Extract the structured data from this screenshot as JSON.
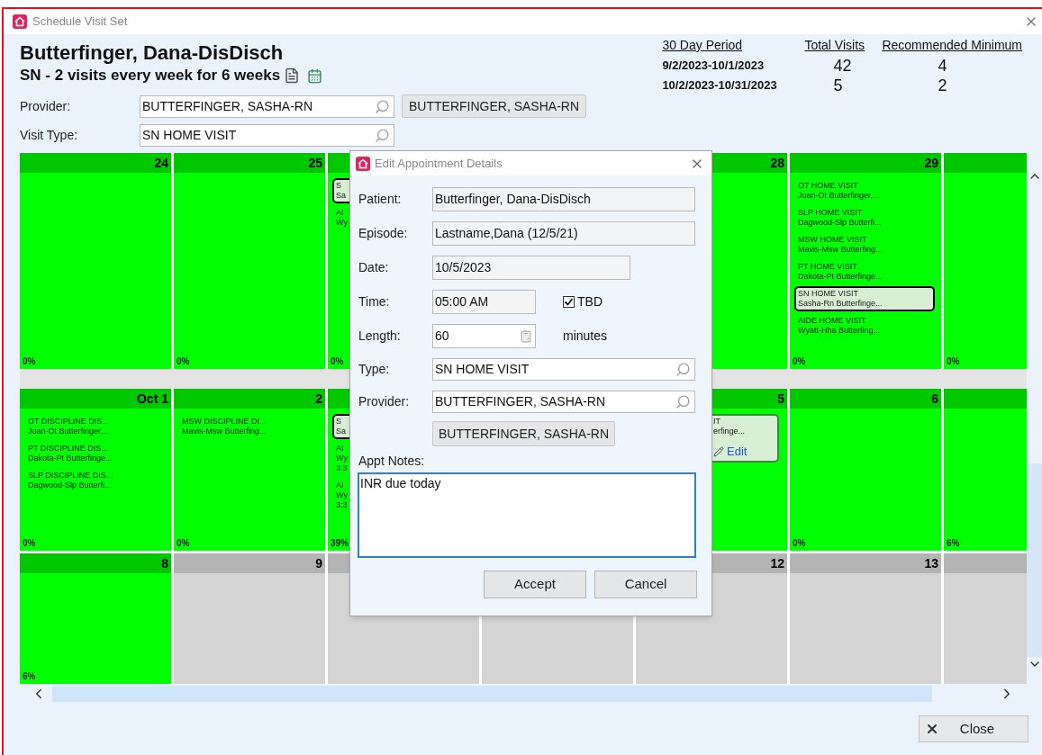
{
  "window": {
    "title": "Schedule Visit Set"
  },
  "header": {
    "patient": "Butterfinger, Dana-DisDisch",
    "plan": "SN - 2 visits every week for 6 weeks"
  },
  "provider": {
    "label": "Provider:",
    "value": "BUTTERFINGER, SASHA-RN",
    "button": "BUTTERFINGER, SASHA-RN"
  },
  "visit_type": {
    "label": "Visit Type:",
    "value": "SN HOME VISIT"
  },
  "periods": {
    "columns": [
      "30 Day Period",
      "Total Visits",
      "Recommended Minimum"
    ],
    "rows": [
      {
        "period": "9/2/2023-10/1/2023",
        "total": "42",
        "minimum": "4"
      },
      {
        "period": "10/2/2023-10/31/2023",
        "total": "5",
        "minimum": "2"
      }
    ]
  },
  "calendar": {
    "weeks": [
      {
        "days": [
          {
            "day": "24",
            "in_range": true,
            "percent": "0%"
          },
          {
            "day": "25",
            "in_range": true,
            "percent": "0%"
          },
          {
            "in_range": true,
            "percent": "0%",
            "visits": [
              {
                "kind": "card",
                "lines": [
                  "S",
                  "Sa"
                ],
                "selected": true
              },
              {
                "kind": "entry",
                "lines": [
                  "AI",
                  "Wy"
                ],
                "selected": false
              }
            ]
          },
          {
            "day": "28",
            "in_range": true
          },
          {
            "day": "29",
            "in_range": true,
            "percent": "0%",
            "visits": [
              {
                "kind": "entry",
                "lines": [
                  "OT HOME VISIT",
                  "Joan-Ot Butterfinger,..."
                ],
                "selected": false
              },
              {
                "kind": "entry",
                "lines": [
                  "SLP HOME VISIT",
                  "Dagwood-Slp Butterfi..."
                ],
                "selected": false
              },
              {
                "kind": "entry",
                "lines": [
                  "MSW HOME VISIT",
                  "Mavis-Msw Butterfing..."
                ],
                "selected": false
              },
              {
                "kind": "entry",
                "lines": [
                  "PT HOME VISIT",
                  "Dakota-Pt Butterfinge..."
                ],
                "selected": false
              },
              {
                "kind": "card",
                "lines": [
                  "SN HOME VISIT",
                  "Sasha-Rn Butterfinge..."
                ],
                "selected": true
              },
              {
                "kind": "entry",
                "lines": [
                  "AIDE HOME VISIT",
                  "Wyatt-Hha Butterfing..."
                ],
                "selected": false
              }
            ]
          },
          {
            "in_range": true,
            "percent": "0%"
          }
        ]
      },
      {
        "days": [
          {
            "day": "Oct 1",
            "in_range": true,
            "percent": "0%",
            "visits": [
              {
                "kind": "entry",
                "lines": [
                  "OT DISCIPLINE DIS...",
                  "Joan-Ot Butterfinger,..."
                ],
                "selected": false
              },
              {
                "kind": "entry",
                "lines": [
                  "PT DISCIPLINE DIS...",
                  "Dakota-Pt Butterfinge..."
                ],
                "selected": false
              },
              {
                "kind": "entry",
                "lines": [
                  "SLP DISCIPLINE DIS...",
                  "Dagwood-Slp Butterfi..."
                ],
                "selected": false
              }
            ]
          },
          {
            "day": "2",
            "in_range": true,
            "percent": "0%",
            "visits": [
              {
                "kind": "entry",
                "lines": [
                  "MSW DISCIPLINE DI...",
                  "Mavis-Msw Butterfing..."
                ],
                "selected": false
              }
            ]
          },
          {
            "in_range": true,
            "percent": "39%",
            "visits": [
              {
                "kind": "card",
                "lines": [
                  "S",
                  "Sa"
                ],
                "selected": true
              },
              {
                "kind": "entry",
                "lines": [
                  "AI",
                  "Wy",
                  "3:3"
                ],
                "selected": false
              },
              {
                "kind": "entry",
                "lines": [
                  "AI",
                  "Wy",
                  "3:3"
                ],
                "selected": false
              }
            ]
          },
          {
            "day": "5",
            "in_range": true,
            "visits": [
              {
                "kind": "card_tail",
                "lines": [
                  "IT",
                  "erfinge..."
                ],
                "selected": false,
                "action": "Edit"
              }
            ]
          },
          {
            "day": "6",
            "in_range": true,
            "percent": "0%"
          },
          {
            "in_range": true,
            "percent": "6%"
          }
        ]
      },
      {
        "days": [
          {
            "day": "8",
            "in_range": true,
            "percent": "6%"
          },
          {
            "day": "9",
            "in_range": false
          },
          {
            "in_range": false
          },
          {
            "day": "12",
            "in_range": false
          },
          {
            "day": "13",
            "in_range": false
          },
          {
            "in_range": false
          }
        ]
      }
    ]
  },
  "dialog": {
    "title": "Edit Appointment Details",
    "fields": [
      {
        "kind": "readonly",
        "label": "Patient:",
        "value": "Butterfinger, Dana-DisDisch"
      },
      {
        "kind": "readonly",
        "label": "Episode:",
        "value": "Lastname,Dana (12/5/21)"
      },
      {
        "kind": "date",
        "label": "Date:",
        "value": "10/5/2023"
      },
      {
        "kind": "time",
        "label": "Time:",
        "value": "05:00 AM",
        "checkbox": {
          "label": "TBD",
          "checked": true
        }
      },
      {
        "kind": "spin",
        "label": "Length:",
        "value": "60",
        "unit": "minutes"
      },
      {
        "kind": "lookup",
        "label": "Type:",
        "value": "SN HOME VISIT"
      },
      {
        "kind": "lookup",
        "label": "Provider:",
        "value": "BUTTERFINGER, SASHA-RN",
        "button": "BUTTERFINGER, SASHA-RN"
      }
    ],
    "notes": {
      "label": "Appt Notes:",
      "value": "INR due today"
    },
    "buttons": [
      "Accept",
      "Cancel"
    ]
  },
  "close_button": "Close"
}
